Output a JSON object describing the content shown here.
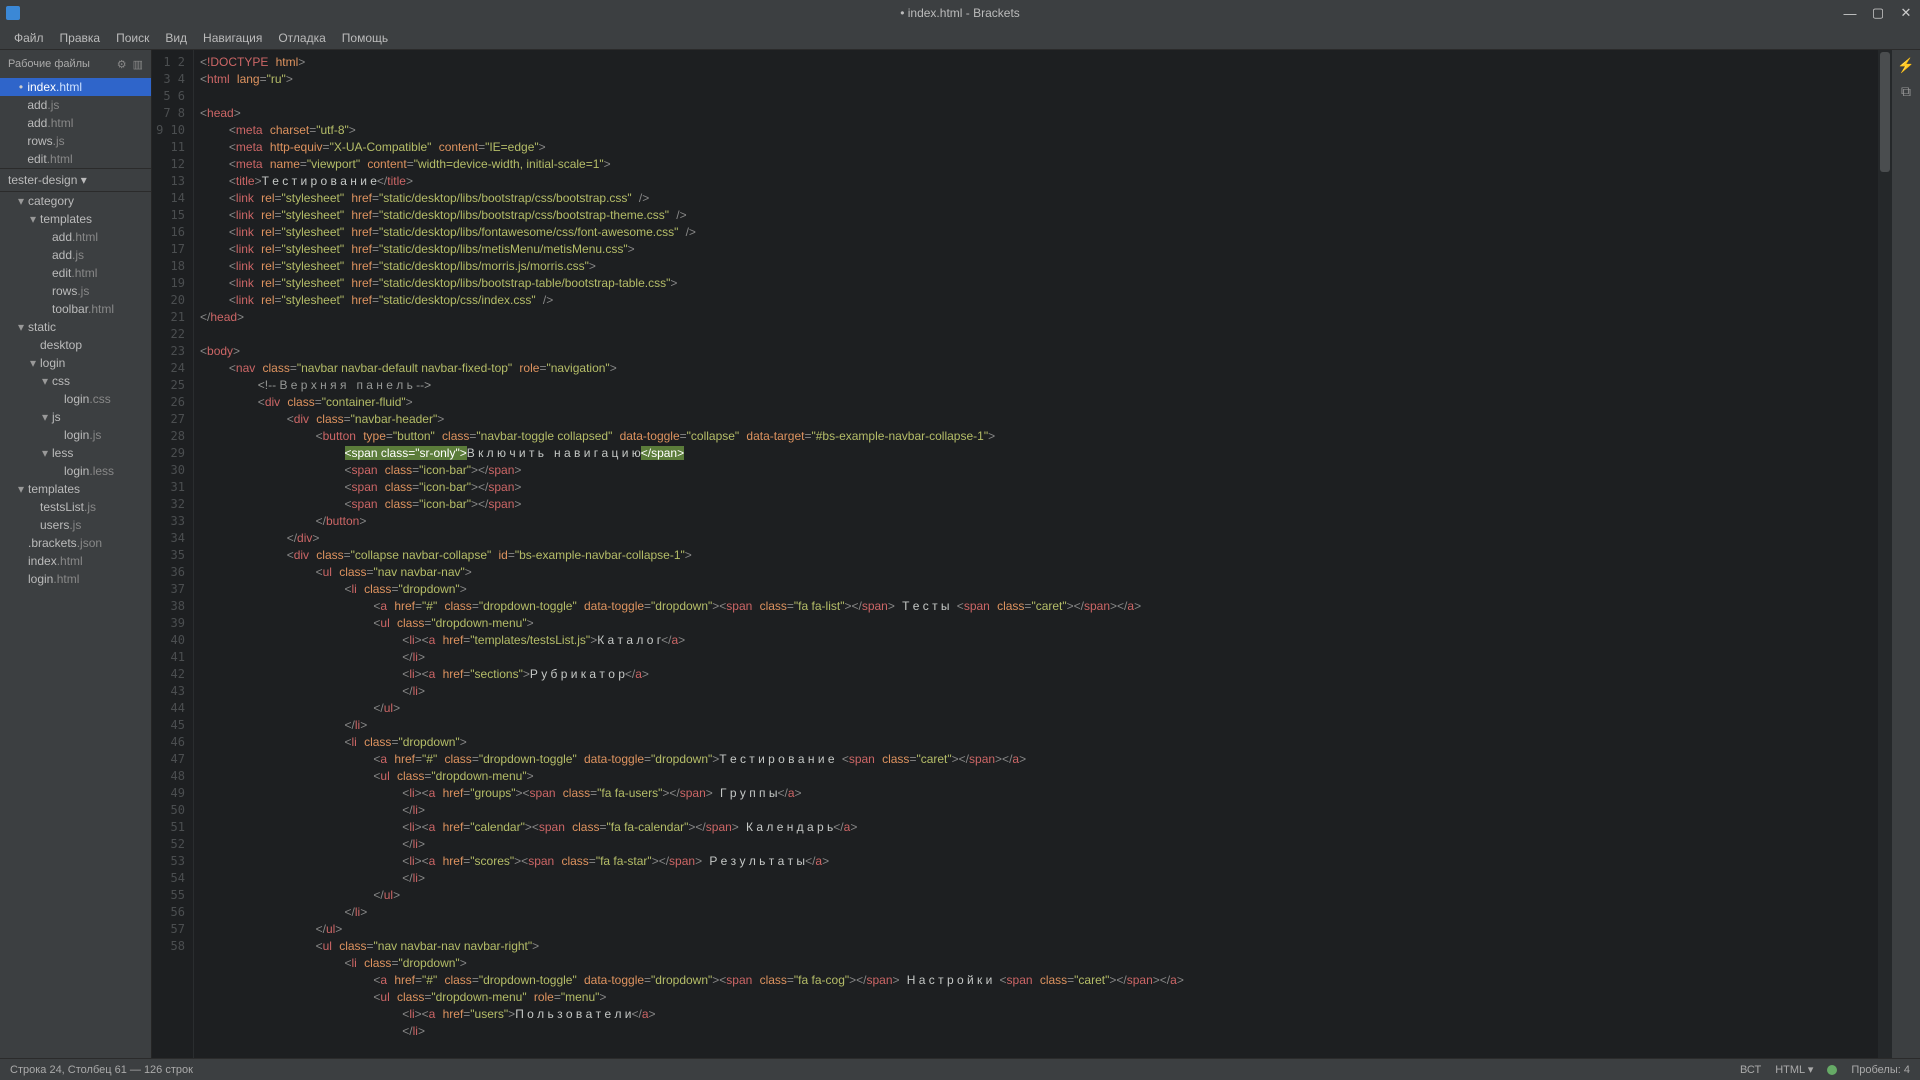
{
  "title": "• index.html - Brackets",
  "menu": [
    "Файл",
    "Правка",
    "Поиск",
    "Вид",
    "Навигация",
    "Отладка",
    "Помощь"
  ],
  "sidebar": {
    "header": "Рабочие файлы",
    "working": [
      {
        "dot": "•",
        "name": "index",
        "ext": ".html",
        "sel": true
      },
      {
        "dot": "",
        "name": "add",
        "ext": ".js"
      },
      {
        "dot": "",
        "name": "add",
        "ext": ".html"
      },
      {
        "dot": "",
        "name": "rows",
        "ext": ".js"
      },
      {
        "dot": "",
        "name": "edit",
        "ext": ".html"
      }
    ],
    "project": "tester-design ▾",
    "tree": [
      {
        "d": 1,
        "tri": "▾",
        "name": "category",
        "ext": ""
      },
      {
        "d": 2,
        "tri": "▾",
        "name": "templates",
        "ext": ""
      },
      {
        "d": 3,
        "tri": "",
        "name": "add",
        "ext": ".html"
      },
      {
        "d": 3,
        "tri": "",
        "name": "add",
        "ext": ".js"
      },
      {
        "d": 3,
        "tri": "",
        "name": "edit",
        "ext": ".html"
      },
      {
        "d": 3,
        "tri": "",
        "name": "rows",
        "ext": ".js"
      },
      {
        "d": 3,
        "tri": "",
        "name": "toolbar",
        "ext": ".html"
      },
      {
        "d": 1,
        "tri": "▾",
        "name": "static",
        "ext": ""
      },
      {
        "d": 2,
        "tri": "",
        "name": "desktop",
        "ext": ""
      },
      {
        "d": 2,
        "tri": "▾",
        "name": "login",
        "ext": ""
      },
      {
        "d": 3,
        "tri": "▾",
        "name": "css",
        "ext": ""
      },
      {
        "d": 4,
        "tri": "",
        "name": "login",
        "ext": ".css"
      },
      {
        "d": 3,
        "tri": "▾",
        "name": "js",
        "ext": ""
      },
      {
        "d": 4,
        "tri": "",
        "name": "login",
        "ext": ".js"
      },
      {
        "d": 3,
        "tri": "▾",
        "name": "less",
        "ext": ""
      },
      {
        "d": 4,
        "tri": "",
        "name": "login",
        "ext": ".less"
      },
      {
        "d": 1,
        "tri": "▾",
        "name": "templates",
        "ext": ""
      },
      {
        "d": 2,
        "tri": "",
        "name": "testsList",
        "ext": ".js"
      },
      {
        "d": 2,
        "tri": "",
        "name": "users",
        "ext": ".js"
      },
      {
        "d": 1,
        "tri": "",
        "name": ".brackets",
        "ext": ".json"
      },
      {
        "d": 1,
        "tri": "",
        "name": "index",
        "ext": ".html"
      },
      {
        "d": 1,
        "tri": "",
        "name": "login",
        "ext": ".html"
      }
    ]
  },
  "status": {
    "left": "Строка 24, Столбец 61 — 126 строк",
    "enc": "ВСТ",
    "lang": "HTML ▾",
    "spaces": "Пробелы: 4"
  },
  "lines": 58
}
